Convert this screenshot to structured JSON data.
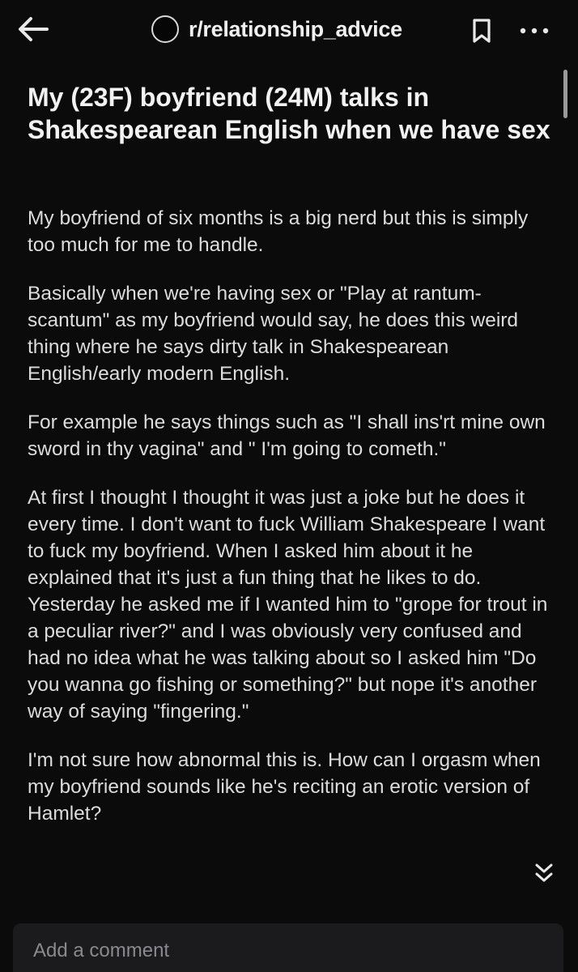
{
  "header": {
    "back_icon": "arrow-left-icon",
    "subreddit": "r/relationship_advice",
    "bookmark_icon": "bookmark-icon",
    "more_icon": "more-dots-icon"
  },
  "post": {
    "title": "My (23F) boyfriend (24M) talks in Shakespearean English when we have sex",
    "paragraphs": [
      "My boyfriend of six months is a big nerd but this is simply too much for me to handle.",
      "Basically when we're having sex or \"Play at rantum-scantum\" as my boyfriend would say, he does this weird thing where he says dirty talk in Shakespearean English/early modern English.",
      "For example he says things such as \"I shall ins'rt mine own sword in thy vagina\" and \" I'm going to cometh.\"",
      "At first I thought I thought it was just a joke but he does it every time. I don't want to fuck William Shakespeare I want to fuck my boyfriend. When I asked him about it he explained that it's just a fun thing that he likes to do. Yesterday he asked me if I wanted him to \"grope for trout in a peculiar river?\" and I was obviously very confused and had no idea what he was talking about so I asked him \"Do you wanna go fishing or something?\" but nope it's another way of saying \"fingering.\"",
      "I'm not sure how abnormal this is. How can I orgasm when my boyfriend sounds like he's reciting an erotic version of Hamlet?"
    ],
    "expand_icon": "double-chevron-down-icon"
  },
  "comment": {
    "placeholder": "Add a comment"
  },
  "colors": {
    "background": "#0b0b0c",
    "text": "#dcdcdc",
    "comment_bar": "#1b1b1d"
  }
}
